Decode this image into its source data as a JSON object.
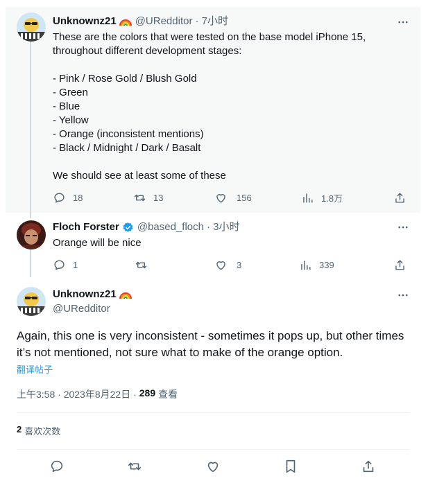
{
  "tweet1": {
    "name": "Unknownz21",
    "handle": "@URedditor",
    "time": "· 7小时",
    "text_lines": [
      "These are the colors that were tested on the base model iPhone 15,",
      "throughout different development stages:",
      "",
      "- Pink / Rose Gold / Blush Gold",
      "- Green",
      "- Blue",
      "- Yellow",
      "- Orange (inconsistent mentions)",
      "- Black / Midnight / Dark / Basalt",
      "",
      "We should see at least some of these"
    ],
    "replies": "18",
    "retweets": "13",
    "likes": "156",
    "views": "1.8万"
  },
  "tweet2": {
    "name": "Floch Forster",
    "handle": "@based_floch",
    "time": "· 3小时",
    "text": "Orange will be nice",
    "replies": "1",
    "retweets": "",
    "likes": "3",
    "views": "339"
  },
  "main_tweet": {
    "name": "Unknownz21",
    "handle": "@URedditor",
    "text": "Again, this one is very inconsistent - sometimes it pops up, but other times it’s not mentioned, not sure what to make of the orange option.",
    "translate_label": "翻译帖子",
    "timestamp": "上午3:58 · 2023年8月22日 ·",
    "views_count": "289",
    "views_label": "查看",
    "likes_count": "2",
    "likes_label": "喜欢次数"
  },
  "colors": {
    "accent": "#1d9bf0",
    "secondary_text": "#536471",
    "highlight_bg": "#f7f9f9"
  }
}
